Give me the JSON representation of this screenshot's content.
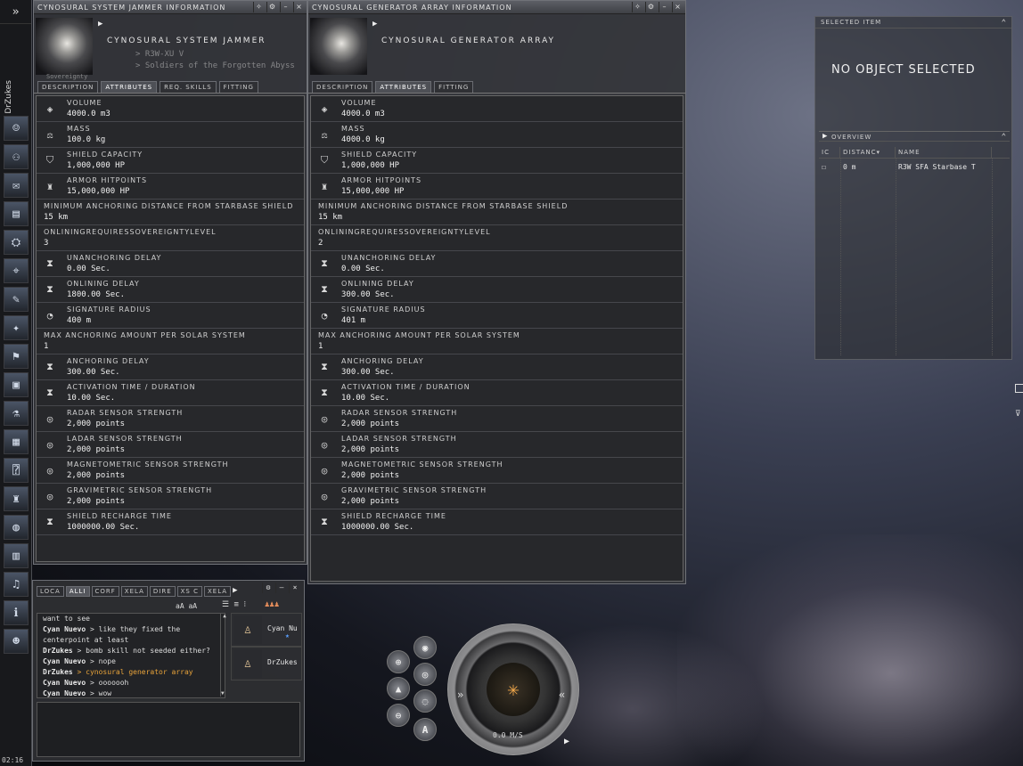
{
  "sidebar": {
    "expand_icon": "»",
    "pilot_name": "DrZukes",
    "icons": [
      "portrait-icon",
      "people-icon",
      "mail-icon",
      "notepad-icon",
      "corporation-icon",
      "map-icon",
      "contracts-icon",
      "starmap-icon",
      "fleet-icon",
      "assets-icon",
      "science-icon",
      "calculator-icon",
      "help-icon",
      "people-places-icon",
      "browser-icon",
      "journal-icon",
      "audio-icon",
      "info-icon",
      "character-icon"
    ],
    "clock": "02:16"
  },
  "jammer_window": {
    "title": "CYNOSURAL SYSTEM JAMMER INFORMATION",
    "name": "CYNOSURAL SYSTEM JAMMER",
    "ghost": [
      "> R3W-XU V",
      "> Soldiers of the Forgotten Abyss",
      "Sovereignty"
    ],
    "tabs": [
      "DESCRIPTION",
      "ATTRIBUTES",
      "REQ. SKILLS",
      "FITTING"
    ],
    "active_tab": 1,
    "attributes": [
      {
        "label": "VOLUME",
        "value": "4000.0 m3",
        "icon": "volume-icon",
        "glyph": "◈"
      },
      {
        "label": "MASS",
        "value": "100.0 kg",
        "icon": "mass-icon",
        "glyph": "⚖"
      },
      {
        "label": "SHIELD CAPACITY",
        "value": "1,000,000 HP",
        "icon": "shield-icon",
        "glyph": "⛉"
      },
      {
        "label": "ARMOR HITPOINTS",
        "value": "15,000,000 HP",
        "icon": "armor-icon",
        "glyph": "♜"
      },
      {
        "label": "MINIMUM ANCHORING DISTANCE FROM STARBASE SHIELD",
        "value": "15 km",
        "icon": "",
        "glyph": ""
      },
      {
        "label": "ONLININGREQUIRESSOVEREIGNTYLEVEL",
        "value": "3",
        "icon": "",
        "glyph": ""
      },
      {
        "label": "UNANCHORING DELAY",
        "value": "0.00 Sec.",
        "icon": "hourglass-icon",
        "glyph": "⧗"
      },
      {
        "label": "ONLINING DELAY",
        "value": "1800.00 Sec.",
        "icon": "hourglass-icon",
        "glyph": "⧗"
      },
      {
        "label": "SIGNATURE RADIUS",
        "value": "400 m",
        "icon": "signature-icon",
        "glyph": "◔"
      },
      {
        "label": "MAX ANCHORING AMOUNT PER SOLAR SYSTEM",
        "value": "1",
        "icon": "",
        "glyph": ""
      },
      {
        "label": "ANCHORING DELAY",
        "value": "300.00 Sec.",
        "icon": "hourglass-icon",
        "glyph": "⧗"
      },
      {
        "label": "ACTIVATION TIME / DURATION",
        "value": "10.00 Sec.",
        "icon": "hourglass-icon",
        "glyph": "⧗"
      },
      {
        "label": "RADAR SENSOR STRENGTH",
        "value": "2,000 points",
        "icon": "radar-sensor-icon",
        "glyph": "◎"
      },
      {
        "label": "LADAR SENSOR STRENGTH",
        "value": "2,000 points",
        "icon": "ladar-sensor-icon",
        "glyph": "◎"
      },
      {
        "label": "MAGNETOMETRIC SENSOR STRENGTH",
        "value": "2,000 points",
        "icon": "magnetometric-sensor-icon",
        "glyph": "◎"
      },
      {
        "label": "GRAVIMETRIC SENSOR STRENGTH",
        "value": "2,000 points",
        "icon": "gravimetric-sensor-icon",
        "glyph": "◎"
      },
      {
        "label": "SHIELD RECHARGE TIME",
        "value": "1000000.00 Sec.",
        "icon": "hourglass-icon",
        "glyph": "⧗"
      }
    ]
  },
  "generator_window": {
    "title": "CYNOSURAL GENERATOR ARRAY INFORMATION",
    "name": "CYNOSURAL GENERATOR ARRAY",
    "tabs": [
      "DESCRIPTION",
      "ATTRIBUTES",
      "FITTING"
    ],
    "active_tab": 1,
    "attributes": [
      {
        "label": "VOLUME",
        "value": "4000.0 m3",
        "icon": "volume-icon",
        "glyph": "◈"
      },
      {
        "label": "MASS",
        "value": "4000.0 kg",
        "icon": "mass-icon",
        "glyph": "⚖"
      },
      {
        "label": "SHIELD CAPACITY",
        "value": "1,000,000 HP",
        "icon": "shield-icon",
        "glyph": "⛉"
      },
      {
        "label": "ARMOR HITPOINTS",
        "value": "15,000,000 HP",
        "icon": "armor-icon",
        "glyph": "♜"
      },
      {
        "label": "MINIMUM ANCHORING DISTANCE FROM STARBASE SHIELD",
        "value": "15 km",
        "icon": "",
        "glyph": ""
      },
      {
        "label": "ONLININGREQUIRESSOVEREIGNTYLEVEL",
        "value": "2",
        "icon": "",
        "glyph": ""
      },
      {
        "label": "UNANCHORING DELAY",
        "value": "0.00 Sec.",
        "icon": "hourglass-icon",
        "glyph": "⧗"
      },
      {
        "label": "ONLINING DELAY",
        "value": "300.00 Sec.",
        "icon": "hourglass-icon",
        "glyph": "⧗"
      },
      {
        "label": "SIGNATURE RADIUS",
        "value": "401 m",
        "icon": "signature-icon",
        "glyph": "◔"
      },
      {
        "label": "MAX ANCHORING AMOUNT PER SOLAR SYSTEM",
        "value": "1",
        "icon": "",
        "glyph": ""
      },
      {
        "label": "ANCHORING DELAY",
        "value": "300.00 Sec.",
        "icon": "hourglass-icon",
        "glyph": "⧗"
      },
      {
        "label": "ACTIVATION TIME / DURATION",
        "value": "10.00 Sec.",
        "icon": "hourglass-icon",
        "glyph": "⧗"
      },
      {
        "label": "RADAR SENSOR STRENGTH",
        "value": "2,000 points",
        "icon": "radar-sensor-icon",
        "glyph": "◎"
      },
      {
        "label": "LADAR SENSOR STRENGTH",
        "value": "2,000 points",
        "icon": "ladar-sensor-icon",
        "glyph": "◎"
      },
      {
        "label": "MAGNETOMETRIC SENSOR STRENGTH",
        "value": "2,000 points",
        "icon": "magnetometric-sensor-icon",
        "glyph": "◎"
      },
      {
        "label": "GRAVIMETRIC SENSOR STRENGTH",
        "value": "2,000 points",
        "icon": "gravimetric-sensor-icon",
        "glyph": "◎"
      },
      {
        "label": "SHIELD RECHARGE TIME",
        "value": "1000000.00 Sec.",
        "icon": "hourglass-icon",
        "glyph": "⧗"
      }
    ]
  },
  "selected_item": {
    "title": "SELECTED ITEM",
    "message": "NO OBJECT SELECTED"
  },
  "overview": {
    "title": "OVERVIEW",
    "columns": [
      "IC",
      "DISTANC",
      "NAME"
    ],
    "rows": [
      {
        "icon": "☐",
        "distance": "0 m",
        "name": "R3W SFA Starbase T"
      }
    ]
  },
  "chat": {
    "tabs": [
      "LOCA",
      "ALLI",
      "CORF",
      "XELA",
      "DIRE",
      "XS C",
      "XELA"
    ],
    "active_tab": 1,
    "text_size": "aA aA",
    "messages": [
      {
        "who": "",
        "text": "want to see",
        "hl": false
      },
      {
        "who": "Cyan Nuevo",
        "text": " > like they fixed the",
        "hl": false
      },
      {
        "who": "",
        "text": "  centerpoint at least",
        "hl": false
      },
      {
        "who": "DrZukes",
        "text": " > bomb skill not seeded either?",
        "hl": false
      },
      {
        "who": "Cyan Nuevo",
        "text": " > nope",
        "hl": false
      },
      {
        "who": "DrZukes",
        "text": " > cynosural generator array",
        "hl": true
      },
      {
        "who": "Cyan Nuevo",
        "text": " > ooooooh",
        "hl": false
      },
      {
        "who": "Cyan Nuevo",
        "text": " > wow",
        "hl": false
      }
    ],
    "members": [
      "Cyan Nu",
      "DrZukes"
    ]
  },
  "hud": {
    "speed": "0.0 M/S",
    "left_arrows": "»",
    "right_arrows": "«",
    "play": "▶",
    "buttons": {
      "zoom_in": "⊕",
      "zoom_out": "⊖",
      "autopilot": "A"
    }
  }
}
